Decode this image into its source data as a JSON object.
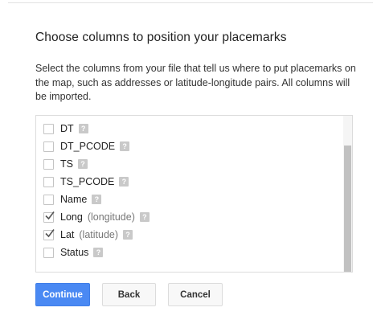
{
  "dialog": {
    "title": "Choose columns to position your placemarks",
    "description": "Select the columns from your file that tell us where to put placemarks on the map, such as addresses or latitude-longitude pairs. All columns will be imported."
  },
  "columns": [
    {
      "label": "DT",
      "sub": "",
      "checked": false
    },
    {
      "label": "DT_PCODE",
      "sub": "",
      "checked": false
    },
    {
      "label": "TS",
      "sub": "",
      "checked": false
    },
    {
      "label": "TS_PCODE",
      "sub": "",
      "checked": false
    },
    {
      "label": "Name",
      "sub": "",
      "checked": false
    },
    {
      "label": "Long",
      "sub": "(longitude)",
      "checked": true
    },
    {
      "label": "Lat",
      "sub": "(latitude)",
      "checked": true
    },
    {
      "label": "Status",
      "sub": "",
      "checked": false
    }
  ],
  "help_icon_glyph": "?",
  "buttons": {
    "continue": "Continue",
    "back": "Back",
    "cancel": "Cancel"
  },
  "colors": {
    "primary": "#4a89f3"
  }
}
